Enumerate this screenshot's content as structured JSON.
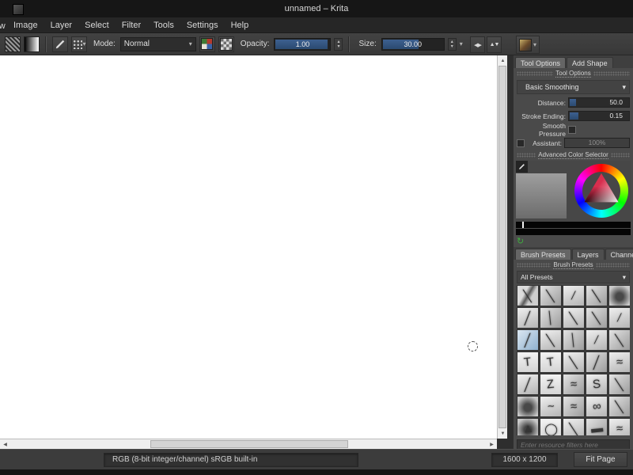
{
  "window": {
    "title": "unnamed – Krita"
  },
  "menu": {
    "partial": "View",
    "items": [
      "Image",
      "Layer",
      "Select",
      "Filter",
      "Tools",
      "Settings",
      "Help"
    ]
  },
  "toolbar": {
    "mode_label": "Mode:",
    "mode_value": "Normal",
    "opacity_label": "Opacity:",
    "opacity_value": "1.00",
    "size_label": "Size:",
    "size_value": "30.00"
  },
  "docker": {
    "tabs": [
      "Tool Options",
      "Add Shape"
    ],
    "title": "Tool Options",
    "smoothing_type": "Basic Smoothing",
    "rows": {
      "distance_label": "Distance:",
      "distance_value": "50.0",
      "stroke_label": "Stroke Ending:",
      "stroke_value": "0.15",
      "smooth_pressure_label": "Smooth Pressure",
      "assistant_label": "Assistant:",
      "assistant_value": "100%"
    },
    "color_title": "Advanced Color Selector",
    "bottom_tabs": [
      "Brush Presets",
      "Layers",
      "Channels"
    ],
    "presets_title": "Brush Presets",
    "all_presets": "All Presets",
    "search_placeholder": "Enter resource filters here"
  },
  "statusbar": {
    "colorspace": "RGB (8-bit integer/channel)  sRGB built-in",
    "canvas_size": "1600 x 1200",
    "fit_page": "Fit Page"
  },
  "icons": {
    "dropdown": "▾",
    "spin_up": "▴",
    "spin_down": "▾",
    "scroll_up": "▲",
    "scroll_down": "▼",
    "scroll_left": "◀",
    "scroll_right": "▶",
    "mirror_h": "◀▶",
    "mirror_v": "▲▼",
    "refresh": "↻"
  },
  "presets": [
    {
      "v": 3,
      "g": "╲"
    },
    {
      "v": 0,
      "g": "╲"
    },
    {
      "v": 1,
      "g": "∕"
    },
    {
      "v": 0,
      "g": "╲"
    },
    {
      "v": 2,
      "g": ""
    },
    {
      "v": 1,
      "g": "╱"
    },
    {
      "v": 0,
      "g": "│"
    },
    {
      "v": 1,
      "g": "╲"
    },
    {
      "v": 0,
      "g": "╲"
    },
    {
      "v": 1,
      "g": "∕"
    },
    {
      "v": 4,
      "g": "╱"
    },
    {
      "v": 1,
      "g": "╲"
    },
    {
      "v": 0,
      "g": "│"
    },
    {
      "v": 1,
      "g": "∕"
    },
    {
      "v": 0,
      "g": "╲"
    },
    {
      "v": 5,
      "g": "T"
    },
    {
      "v": 5,
      "g": "T"
    },
    {
      "v": 1,
      "g": "╲"
    },
    {
      "v": 0,
      "g": "╱"
    },
    {
      "v": 1,
      "g": "≈"
    },
    {
      "v": 1,
      "g": "╱"
    },
    {
      "v": 5,
      "g": "Z"
    },
    {
      "v": 0,
      "g": "≈"
    },
    {
      "v": 1,
      "g": "S"
    },
    {
      "v": 0,
      "g": "╲"
    },
    {
      "v": 2,
      "g": ""
    },
    {
      "v": 1,
      "g": "~"
    },
    {
      "v": 0,
      "g": "≈"
    },
    {
      "v": 1,
      "g": "∞"
    },
    {
      "v": 0,
      "g": "╲"
    },
    {
      "v": 2,
      "g": "▲"
    },
    {
      "v": 5,
      "g": "◯"
    },
    {
      "v": 1,
      "g": "╲"
    },
    {
      "v": 0,
      "g": "▬"
    },
    {
      "v": 1,
      "g": "≈"
    }
  ]
}
